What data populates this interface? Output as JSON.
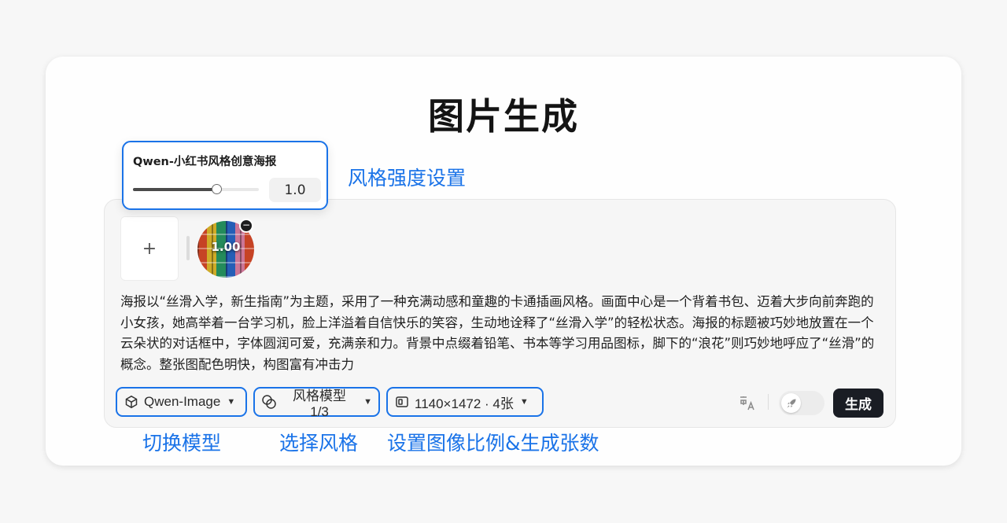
{
  "page": {
    "title": "图片生成"
  },
  "style_popover": {
    "title": "Qwen-小红书风格创意海报",
    "slider_fraction": 0.66,
    "value": "1.0"
  },
  "upload": {
    "add_label": "+"
  },
  "reference_image": {
    "strength_label": "1.00",
    "remove_label": "−"
  },
  "prompt_text": "海报以“丝滑入学，新生指南”为主题，采用了一种充满动感和童趣的卡通插画风格。画面中心是一个背着书包、迈着大步向前奔跑的小女孩，她高举着一台学习机，脸上洋溢着自信快乐的笑容，生动地诠释了“丝滑入学”的轻松状态。海报的标题被巧妙地放置在一个云朵状的对话框中，字体圆润可爱，充满亲和力。背景中点缀着铅笔、书本等学习用品图标，脚下的“浪花”则巧妙地呼应了“丝滑”的概念。整张图配色明快，构图富有冲击力",
  "toolbar": {
    "model_label": "Qwen-Image",
    "style_label": "风格模型 1/3",
    "size_label": "1140×1472 · 4张",
    "generate_label": "生成"
  },
  "annotations": {
    "strength": "风格强度设置",
    "model": "切换模型",
    "style": "选择风格",
    "size": "设置图像比例&生成张数"
  },
  "icons": {
    "model": "cube-icon",
    "style": "overlap-circles-icon",
    "size": "aspect-ratio-icon",
    "translate": "translate-icon",
    "rocket": "rocket-icon"
  },
  "colors": {
    "accent": "#1a73e8",
    "generate_bg": "#1a1d24"
  }
}
